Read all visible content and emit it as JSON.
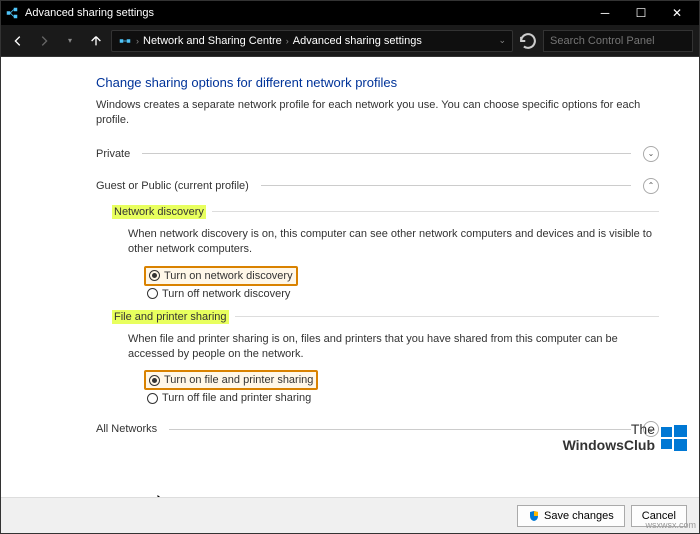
{
  "titlebar": {
    "title": "Advanced sharing settings"
  },
  "nav": {
    "breadcrumb1": "Network and Sharing Centre",
    "breadcrumb2": "Advanced sharing settings",
    "search_placeholder": "Search Control Panel"
  },
  "page": {
    "heading": "Change sharing options for different network profiles",
    "subtext": "Windows creates a separate network profile for each network you use. You can choose specific options for each profile."
  },
  "profiles": {
    "private": "Private",
    "guest": "Guest or Public (current profile)",
    "all": "All Networks"
  },
  "network_discovery": {
    "title": "Network discovery",
    "desc": "When network discovery is on, this computer can see other network computers and devices and is visible to other network computers.",
    "on": "Turn on network discovery",
    "off": "Turn off network discovery"
  },
  "file_printer": {
    "title": "File and printer sharing",
    "desc": "When file and printer sharing is on, files and printers that you have shared from this computer can be accessed by people on the network.",
    "on": "Turn on file and printer sharing",
    "off": "Turn off file and printer sharing"
  },
  "footer": {
    "save": "Save changes",
    "cancel": "Cancel"
  },
  "watermark": {
    "line1": "The",
    "line2": "WindowsClub"
  },
  "domain_mark": "wsxwsx.com"
}
